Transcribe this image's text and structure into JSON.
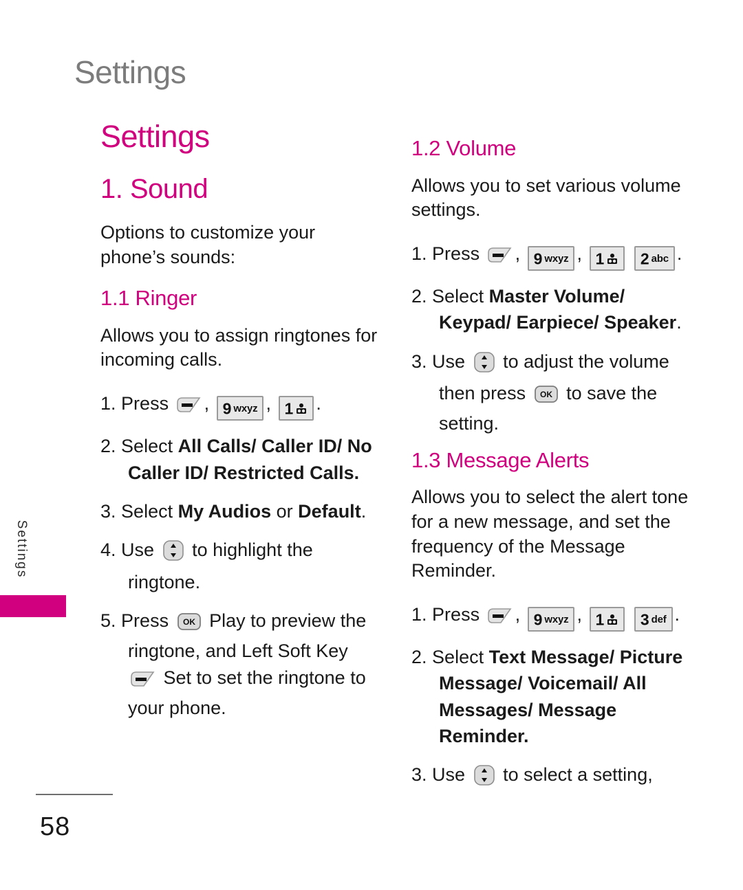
{
  "running_head": "Settings",
  "side_tab": {
    "label": "Settings",
    "block_color": "#d0007e"
  },
  "accent_color": "#d0007e",
  "page_number": "58",
  "left_column": {
    "main_heading": "Settings",
    "section_heading": "1. Sound",
    "intro": "Options to customize your phone’s sounds:",
    "subsection": {
      "heading": "1.1 Ringer",
      "description": "Allows you to assign ringtones for incoming calls.",
      "steps": {
        "s1_num": "1.",
        "s1_press": "Press",
        "s1_comma1": ",",
        "s1_comma2": ",",
        "s1_period": ".",
        "s2_num": "2.",
        "s2_select": "Select",
        "s2_options": "All Calls/ Caller ID/ No Caller ID/ Restricted Calls",
        "s2_period": ".",
        "s3_num": "3.",
        "s3_select": "Select",
        "s3_option_a": "My Audios",
        "s3_or": "or",
        "s3_option_b": "Default",
        "s3_period": ".",
        "s4_num": "4.",
        "s4_use": "Use",
        "s4_tail": "to highlight the ringtone.",
        "s5_num": "5.",
        "s5_press": "Press",
        "s5_mid": "Play to preview the ringtone, and Left Soft Key",
        "s5_tail": "Set to set the ringtone to your phone."
      }
    }
  },
  "right_column": {
    "volume": {
      "heading": "1.2 Volume",
      "description": "Allows you to set various volume settings.",
      "steps": {
        "s1_num": "1.",
        "s1_press": "Press",
        "s1_comma1": ",",
        "s1_comma2": ",",
        "s1_period": ".",
        "s2_num": "2.",
        "s2_select": "Select",
        "s2_options": "Master Volume/ Keypad/ Earpiece/ Speaker",
        "s2_period": ".",
        "s3_num": "3.",
        "s3_use": "Use",
        "s3_mid": "to adjust the volume then press",
        "s3_tail": "to save the setting."
      }
    },
    "message_alerts": {
      "heading": "1.3 Message Alerts",
      "description": "Allows you to select the alert tone for a new message, and set the frequency of the Message Reminder.",
      "steps": {
        "s1_num": "1.",
        "s1_press": "Press",
        "s1_comma1": ",",
        "s1_comma2": ",",
        "s1_period": ".",
        "s2_num": "2.",
        "s2_select": "Select",
        "s2_options": "Text Message/ Picture Message/ Voicemail/ All Messages/ Message Reminder",
        "s2_period": ".",
        "s3_num": "3.",
        "s3_use": "Use",
        "s3_tail": "to select a setting,"
      }
    }
  },
  "keys": {
    "soft_left": "left-soft-key",
    "nav_updown": "navigation-up-down-key",
    "ok": "OK",
    "k9": {
      "digit": "9",
      "letters": "wxyz"
    },
    "k1": {
      "digit": "1",
      "letters": "voicemail"
    },
    "k2": {
      "digit": "2",
      "letters": "abc"
    },
    "k3": {
      "digit": "3",
      "letters": "def"
    }
  }
}
